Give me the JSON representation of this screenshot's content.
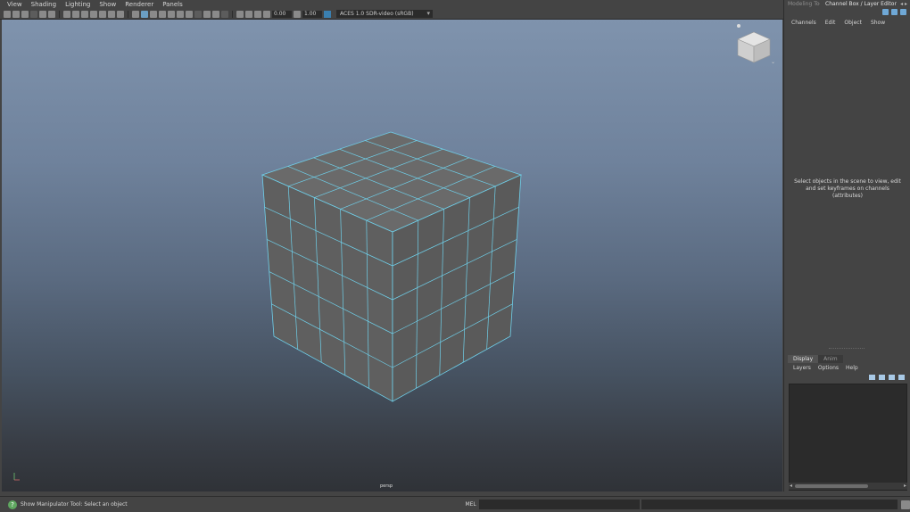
{
  "menubar": {
    "items": [
      "View",
      "Shading",
      "Lighting",
      "Show",
      "Renderer",
      "Panels"
    ]
  },
  "toolbar": {
    "field_a": "0.00",
    "field_b": "1.00",
    "colorspace": "ACES 1.0 SDR-video (sRGB)"
  },
  "viewport": {
    "camera_label": "persp"
  },
  "right_panel": {
    "tab_modeling": "Modeling Toolkit",
    "tab_channel": "Channel Box / Layer Editor",
    "menu": [
      "Channels",
      "Edit",
      "Object",
      "Show"
    ],
    "hint": "Select objects in the scene to view, edit and set keyframes on channels (attributes)",
    "display_tabs": [
      "Display",
      "Anim"
    ],
    "display_menu": [
      "Layers",
      "Options",
      "Help"
    ]
  },
  "statusbar": {
    "help": "Show Manipulator Tool: Select an object",
    "mel_label": "MEL"
  },
  "colors": {
    "accent": "#6fd0ea",
    "cube_face": "#5f5f5f",
    "cube_wire": "#6fd0ea"
  }
}
